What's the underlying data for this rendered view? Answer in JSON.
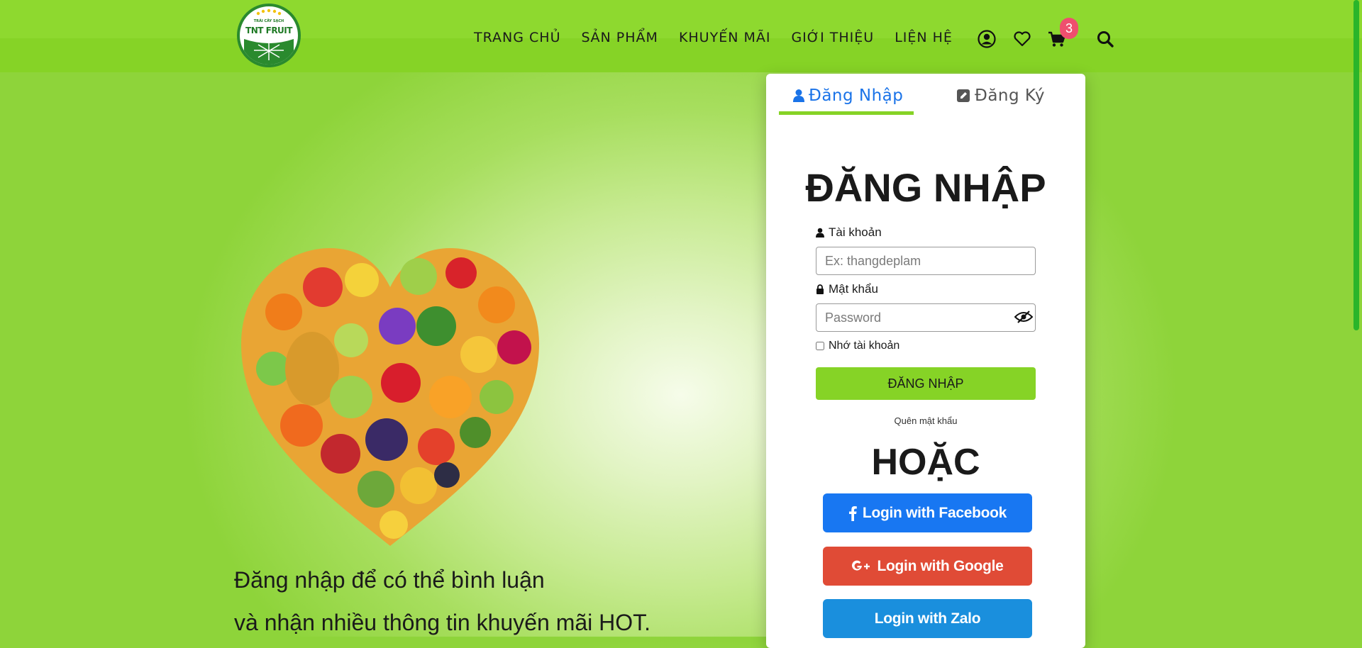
{
  "header": {
    "logo_text": "TNT FRUIT",
    "logo_subtext": "TRÁI CÂY SẠCH",
    "nav": [
      "TRANG CHỦ",
      "SẢN PHẨM",
      "KHUYẾN MÃI",
      "GIỚI THIỆU",
      "LIỆN HỆ"
    ],
    "icons": [
      "user-icon",
      "heart-icon",
      "cart-icon",
      "search-icon"
    ],
    "cart_count": "3"
  },
  "promo": {
    "line1": "Đăng nhập để có thể bình luận",
    "line2": "và nhận nhiều thông tin khuyến mãi HOT."
  },
  "login": {
    "tab_login": "Đăng Nhập",
    "tab_register": "Đăng Ký",
    "title": "ĐĂNG NHẬP",
    "username_label": "Tài khoản",
    "username_placeholder": "Ex: thangdeplam",
    "password_label": "Mật khẩu",
    "password_placeholder": "Password",
    "remember_label": "Nhớ tài khoản",
    "submit_label": "ĐĂNG NHẬP",
    "forgot_label": "Quên mật khẩu",
    "or_label": "HOẶC",
    "facebook_label": "Login with Facebook",
    "google_label": "Login with Google",
    "zalo_label": "Login with Zalo"
  },
  "colors": {
    "brand_green": "#86d326",
    "header_green": "#8ed92f",
    "tab_active": "#1a73e8",
    "facebook": "#1877f2",
    "google": "#e04b36",
    "zalo": "#1a8fdd",
    "badge": "#ef4f6e"
  }
}
